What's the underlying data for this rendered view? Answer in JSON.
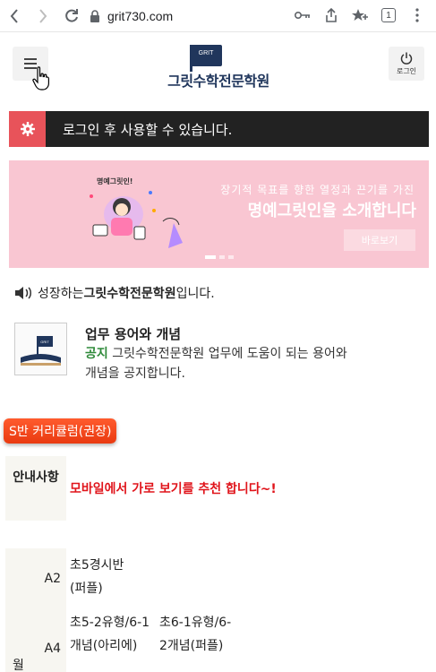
{
  "browser": {
    "url": "grit730.com",
    "tab_count": "1"
  },
  "header": {
    "logo_flag_text": "GRIT",
    "logo_name": "그릿수학전문학원",
    "login_label": "로그인"
  },
  "notice": {
    "text": "로그인 후 사용할 수 있습니다."
  },
  "banner": {
    "subtitle": "장기적 목표를 향한 열정과 끈기를 가진",
    "title": "명예그릿인을 소개합니다",
    "cta": "바로보기",
    "illustration_text": "명예그릿인!"
  },
  "intro": {
    "prefix": "성장하는 ",
    "school": "그릿수학전문학원",
    "suffix": " 입니다."
  },
  "post": {
    "thumb_text": "GRIT",
    "title": "업무 용어와 개념",
    "tag": "공지",
    "desc": " 그릿수학전문학원 업무에 도움이 되는 용어와 개념을 공지합니다."
  },
  "curriculum": {
    "badge": "S반 커리큘럼(권장)",
    "notice_header": "안내사항",
    "notice_body": "모바일에서 가로 보기를 추천 합니다~!",
    "rows": [
      {
        "label": "A2",
        "cells": [
          "초5경시반(퍼플)"
        ]
      },
      {
        "label": "A4",
        "cells": [
          "초5-2유형/6-1개념(아리에)",
          "초6-1유형/6-2개념(퍼플)"
        ]
      }
    ],
    "row_partial_label": "월"
  }
}
